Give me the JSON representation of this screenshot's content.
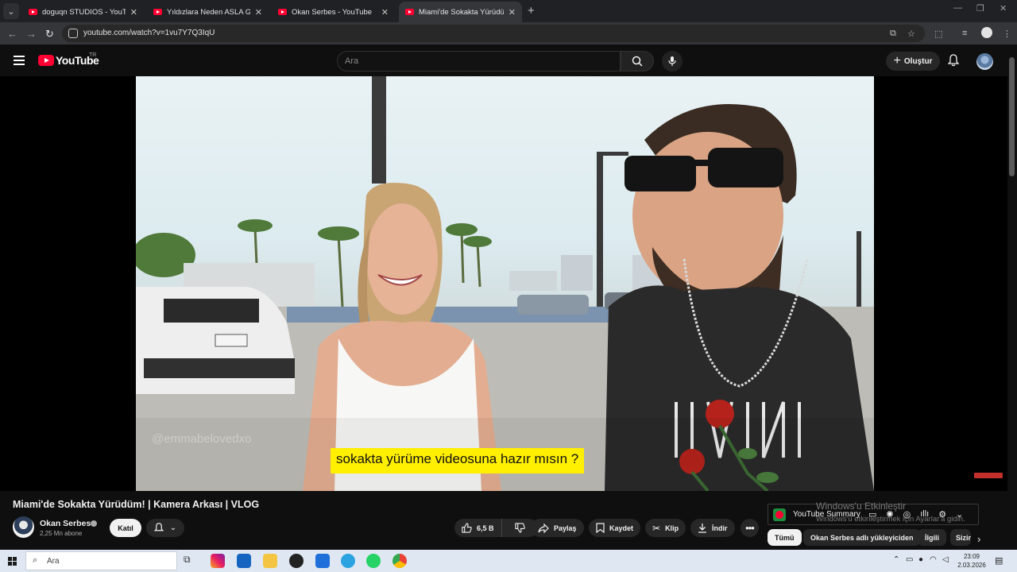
{
  "browser": {
    "tabs": [
      {
        "title": "doguqn STUDIOS - YouTube",
        "active": false
      },
      {
        "title": "Yıldızlara Neden ASLA Gidemey",
        "active": false
      },
      {
        "title": "Okan Serbes - YouTube",
        "active": false
      },
      {
        "title": "Miami'de Sokakta Yürüdüm! | K",
        "active": true
      }
    ],
    "url": "youtube.com/watch?v=1vu7Y7Q3IqU"
  },
  "header": {
    "logo_text": "YouTube",
    "region": "TR",
    "search_placeholder": "Ara",
    "create_label": "Oluştur"
  },
  "player": {
    "caption": "sokakta yürüme videosuna hazır mısın ?",
    "watermark": "@emmabelovedxo"
  },
  "video": {
    "title": "Miami'de Sokakta Yürüdüm! | Kamera Arkası | VLOG",
    "channel": "Okan Serbes",
    "subscribers": "2,25 Mn abone",
    "join_label": "Katıl",
    "likes": "6,5 B",
    "share_label": "Paylaş",
    "save_label": "Kaydet",
    "clip_label": "Klip",
    "download_label": "İndir"
  },
  "summary": {
    "label": "YouTube Summary"
  },
  "watermark_os": {
    "line1": "Windows'u Etkinleştir",
    "line2": "Windows'u etkinleştirmek için Ayarlar'a gidin."
  },
  "chips": [
    "Tümü",
    "Okan Serbes adlı yükleyiciden",
    "İlgili",
    "Sizin"
  ],
  "taskbar": {
    "search_label": "Ara",
    "time": "23:09",
    "date": "2.03.2026"
  },
  "colors": {
    "accent_red": "#ff0033",
    "caption_bg": "#ffef00",
    "background": "#0f0f0f"
  }
}
